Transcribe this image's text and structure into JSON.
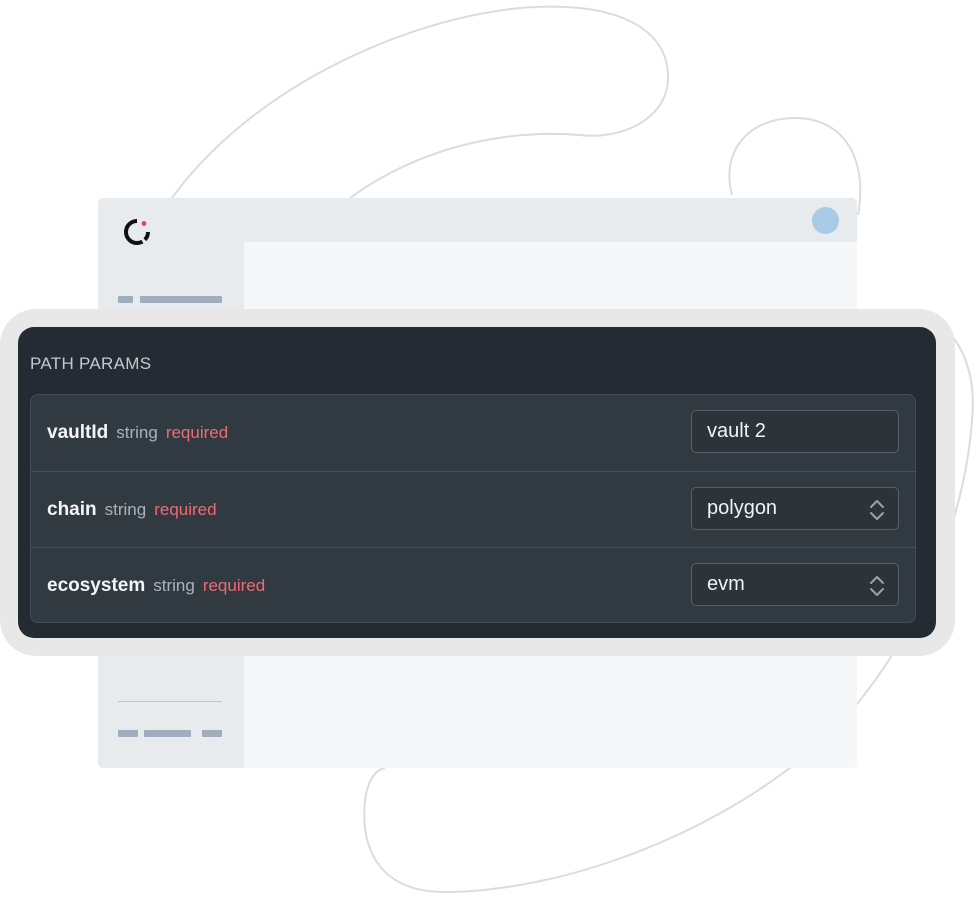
{
  "panel": {
    "title": "PATH PARAMS",
    "params": [
      {
        "name": "vaultId",
        "type": "string",
        "required": "required",
        "value": "vault 2",
        "control": "text-input"
      },
      {
        "name": "chain",
        "type": "string",
        "required": "required",
        "value": "polygon",
        "control": "select"
      },
      {
        "name": "ecosystem",
        "type": "string",
        "required": "required",
        "value": "evm",
        "control": "select"
      }
    ]
  },
  "icons": {
    "logo": "ring-logo-icon",
    "avatar": "user-avatar",
    "select": "chevron-up-down-icon"
  },
  "colors": {
    "panel_bg": "#252b32",
    "row_bg": "#323a41",
    "required": "#ef6a75",
    "avatar": "#a7cbe6",
    "logo_dot": "#e0435b"
  }
}
